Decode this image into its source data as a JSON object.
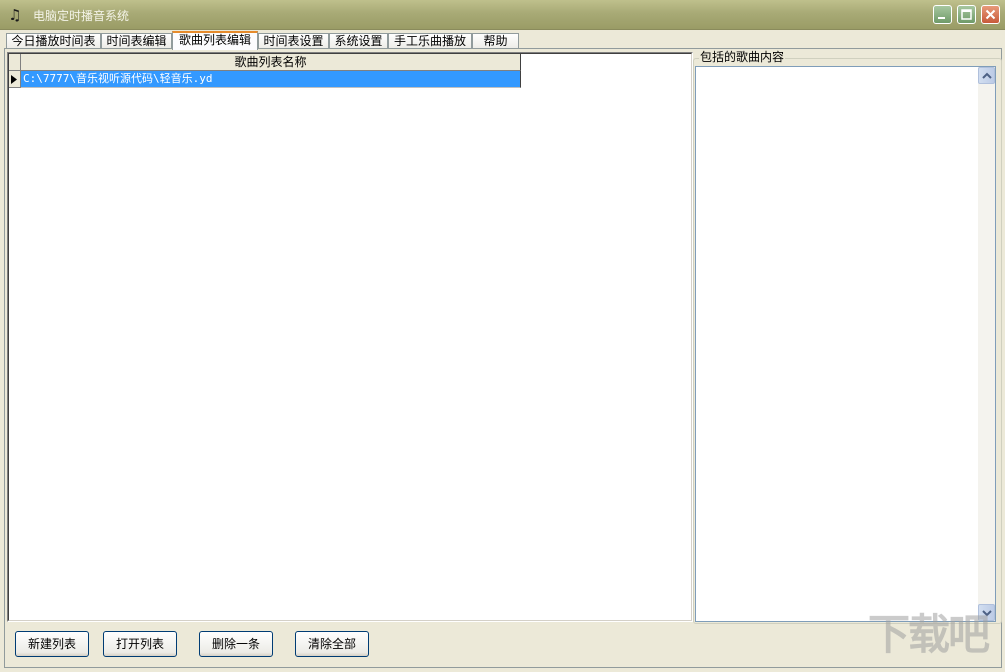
{
  "window": {
    "title": "电脑定时播音系统"
  },
  "tabs": [
    {
      "label": "今日播放时间表",
      "active": false
    },
    {
      "label": "时间表编辑",
      "active": false
    },
    {
      "label": "歌曲列表编辑",
      "active": true
    },
    {
      "label": "时间表设置",
      "active": false
    },
    {
      "label": "系统设置",
      "active": false
    },
    {
      "label": "手工乐曲播放",
      "active": false
    },
    {
      "label": "帮助",
      "active": false
    }
  ],
  "grid": {
    "column_header": "歌曲列表名称",
    "rows": [
      {
        "name": "C:\\7777\\音乐视听源代码\\轻音乐.yd",
        "selected": true
      }
    ]
  },
  "songs_panel": {
    "label": "包括的歌曲内容"
  },
  "buttons": {
    "new_list": "新建列表",
    "open_list": "打开列表",
    "delete_one": "删除一条",
    "clear_all": "清除全部"
  },
  "watermark": {
    "text": "下载吧"
  },
  "colors": {
    "selection": "#3399FF",
    "active_tab_accent": "#E68B2C",
    "window_bg": "#ECE9D8"
  }
}
